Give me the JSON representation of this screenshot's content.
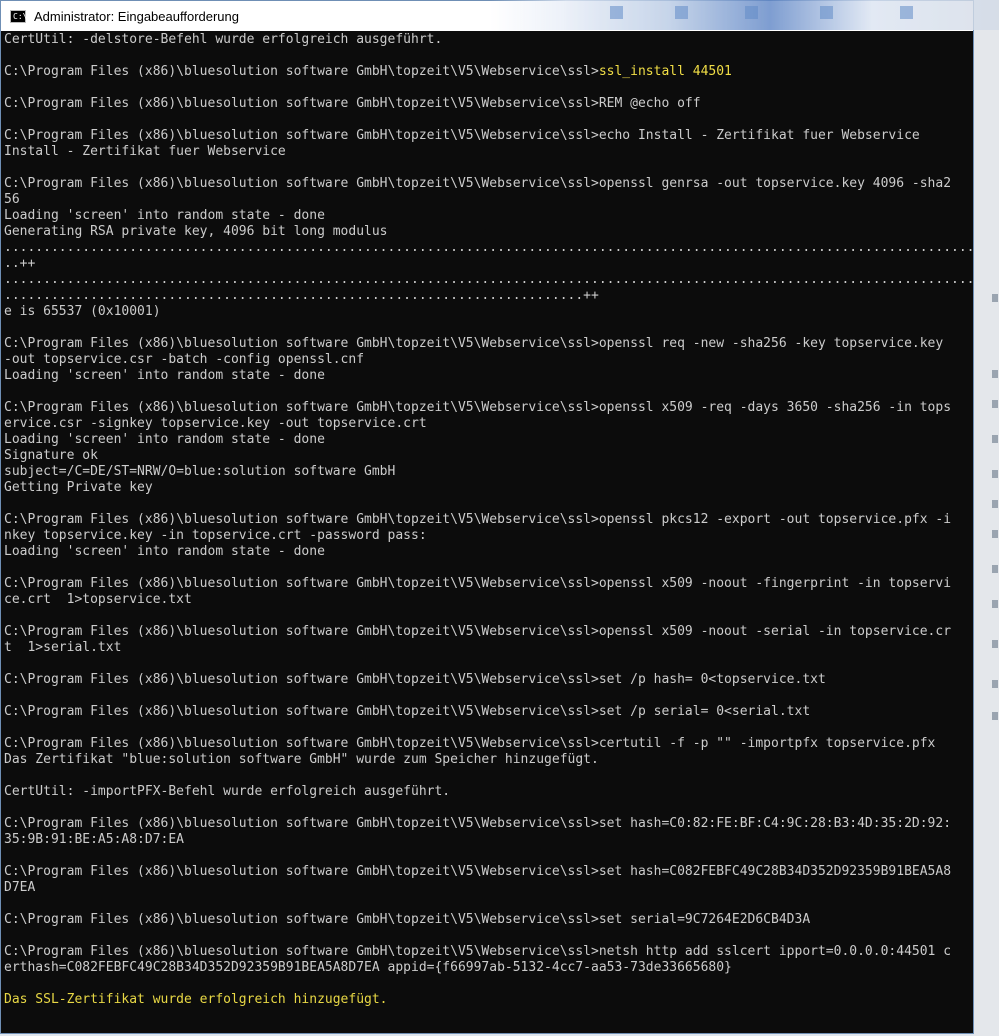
{
  "window": {
    "title": "Administrator: Eingabeaufforderung",
    "icon": "console-icon",
    "icon_glyph": "C:\\"
  },
  "console": {
    "lines": [
      "CertUtil: -delstore-Befehl wurde erfolgreich ausgeführt.",
      "",
      "C:\\Program Files (x86)\\bluesolution software GmbH\\topzeit\\V5\\Webservice\\ssl>ssl_install 44501",
      "",
      "C:\\Program Files (x86)\\bluesolution software GmbH\\topzeit\\V5\\Webservice\\ssl>REM @echo off",
      "",
      "C:\\Program Files (x86)\\bluesolution software GmbH\\topzeit\\V5\\Webservice\\ssl>echo Install - Zertifikat fuer Webservice",
      "Install - Zertifikat fuer Webservice",
      "",
      "C:\\Program Files (x86)\\bluesolution software GmbH\\topzeit\\V5\\Webservice\\ssl>openssl genrsa -out topservice.key 4096 -sha2",
      "56",
      "Loading 'screen' into random state - done",
      "Generating RSA private key, 4096 bit long modulus",
      "................................................................................................................................",
      "..++",
      "................................................................................................................................",
      "..........................................................................++",
      "e is 65537 (0x10001)",
      "",
      "C:\\Program Files (x86)\\bluesolution software GmbH\\topzeit\\V5\\Webservice\\ssl>openssl req -new -sha256 -key topservice.key",
      "-out topservice.csr -batch -config openssl.cnf",
      "Loading 'screen' into random state - done",
      "",
      "C:\\Program Files (x86)\\bluesolution software GmbH\\topzeit\\V5\\Webservice\\ssl>openssl x509 -req -days 3650 -sha256 -in tops",
      "ervice.csr -signkey topservice.key -out topservice.crt",
      "Loading 'screen' into random state - done",
      "Signature ok",
      "subject=/C=DE/ST=NRW/O=blue:solution software GmbH",
      "Getting Private key",
      "",
      "C:\\Program Files (x86)\\bluesolution software GmbH\\topzeit\\V5\\Webservice\\ssl>openssl pkcs12 -export -out topservice.pfx -i",
      "nkey topservice.key -in topservice.crt -password pass:",
      "Loading 'screen' into random state - done",
      "",
      "C:\\Program Files (x86)\\bluesolution software GmbH\\topzeit\\V5\\Webservice\\ssl>openssl x509 -noout -fingerprint -in topservi",
      "ce.crt  1>topservice.txt",
      "",
      "C:\\Program Files (x86)\\bluesolution software GmbH\\topzeit\\V5\\Webservice\\ssl>openssl x509 -noout -serial -in topservice.cr",
      "t  1>serial.txt",
      "",
      "C:\\Program Files (x86)\\bluesolution software GmbH\\topzeit\\V5\\Webservice\\ssl>set /p hash= 0<topservice.txt",
      "",
      "C:\\Program Files (x86)\\bluesolution software GmbH\\topzeit\\V5\\Webservice\\ssl>set /p serial= 0<serial.txt",
      "",
      "C:\\Program Files (x86)\\bluesolution software GmbH\\topzeit\\V5\\Webservice\\ssl>certutil -f -p \"\" -importpfx topservice.pfx",
      "Das Zertifikat \"blue:solution software GmbH\" wurde zum Speicher hinzugefügt.",
      "",
      "CertUtil: -importPFX-Befehl wurde erfolgreich ausgeführt.",
      "",
      "C:\\Program Files (x86)\\bluesolution software GmbH\\topzeit\\V5\\Webservice\\ssl>set hash=C0:82:FE:BF:C4:9C:28:B3:4D:35:2D:92:",
      "35:9B:91:BE:A5:A8:D7:EA",
      "",
      "C:\\Program Files (x86)\\bluesolution software GmbH\\topzeit\\V5\\Webservice\\ssl>set hash=C082FEBFC49C28B34D352D92359B91BEA5A8",
      "D7EA",
      "",
      "C:\\Program Files (x86)\\bluesolution software GmbH\\topzeit\\V5\\Webservice\\ssl>set serial=9C7264E2D6CB4D3A",
      "",
      "C:\\Program Files (x86)\\bluesolution software GmbH\\topzeit\\V5\\Webservice\\ssl>netsh http add sslcert ipport=0.0.0.0:44501 c",
      "erthash=C082FEBFC49C28B34D352D92359B91BEA5A8D7EA appid={f66997ab-5132-4cc7-aa53-73de33665680}",
      "",
      "Das SSL-Zertifikat wurde erfolgreich hinzugefügt.",
      ""
    ],
    "highlight": {
      "prompt": "C:\\Program Files (x86)\\bluesolution software GmbH\\topzeit\\V5\\Webservice\\ssl>",
      "user_command": "ssl_install 44501"
    }
  },
  "colors": {
    "console_bg": "#0c0c0c",
    "console_text": "#cccccc",
    "user_input": "#f1de46",
    "success_text": "#e8d845"
  }
}
